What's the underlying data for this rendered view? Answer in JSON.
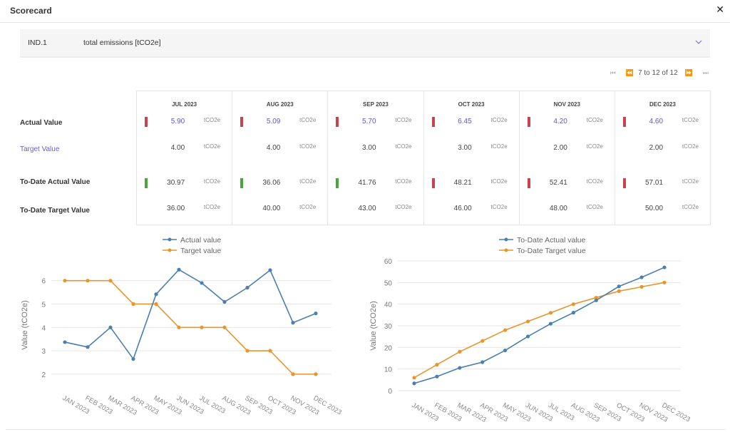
{
  "window": {
    "title": "Scorecard",
    "close_icon": "close-icon"
  },
  "indicator": {
    "code": "IND.1",
    "name": "total emissions [tCO2e]",
    "expand_icon": "chevron-down-icon"
  },
  "pager": {
    "info": "7 to 12 of 12",
    "first": "first-page-icon",
    "prev": "prev-page-icon",
    "next": "next-page-icon",
    "last": "last-page-icon"
  },
  "row_labels": [
    "Actual Value",
    "Target Value",
    "To-Date Actual Value",
    "To-Date Target Value"
  ],
  "unit": "tCO2e",
  "colors": {
    "bad": "#c9434f",
    "good": "#4aa63b",
    "link": "#6a5fc1",
    "actual_line": "#4a7fb0",
    "target_line": "#e8962c"
  },
  "periods": [
    {
      "label": "JUL 2023",
      "actual": "5.90",
      "actual_status": "bad",
      "target": "4.00",
      "todate_actual": "30.97",
      "todate_status": "good",
      "todate_target": "36.00"
    },
    {
      "label": "AUG 2023",
      "actual": "5.09",
      "actual_status": "bad",
      "target": "4.00",
      "todate_actual": "36.06",
      "todate_status": "good",
      "todate_target": "40.00"
    },
    {
      "label": "SEP 2023",
      "actual": "5.70",
      "actual_status": "bad",
      "target": "3.00",
      "todate_actual": "41.76",
      "todate_status": "good",
      "todate_target": "43.00"
    },
    {
      "label": "OCT 2023",
      "actual": "6.45",
      "actual_status": "bad",
      "target": "3.00",
      "todate_actual": "48.21",
      "todate_status": "bad",
      "todate_target": "46.00"
    },
    {
      "label": "NOV 2023",
      "actual": "4.20",
      "actual_status": "bad",
      "target": "2.00",
      "todate_actual": "52.41",
      "todate_status": "bad",
      "todate_target": "48.00"
    },
    {
      "label": "DEC 2023",
      "actual": "4.60",
      "actual_status": "bad",
      "target": "2.00",
      "todate_actual": "57.01",
      "todate_status": "bad",
      "todate_target": "50.00"
    }
  ],
  "chart_data": [
    {
      "type": "line",
      "title": "",
      "xlabel": "",
      "ylabel": "Value (tCO2e)",
      "categories": [
        "JAN 2023",
        "FEB 2023",
        "MAR 2023",
        "APR 2023",
        "MAY 2023",
        "JUN 2023",
        "JUL 2023",
        "AUG 2023",
        "SEP 2023",
        "OCT 2023",
        "NOV 2023",
        "DEC 2023"
      ],
      "yticks": [
        2,
        3,
        4,
        5,
        6
      ],
      "ylim": [
        1.6,
        6.6
      ],
      "grid": true,
      "legend": "top-center",
      "series": [
        {
          "name": "Actual value",
          "color": "#4a7fb0",
          "values": [
            3.37,
            3.16,
            4.0,
            2.65,
            5.42,
            6.47,
            5.9,
            5.09,
            5.7,
            6.45,
            4.2,
            4.6
          ]
        },
        {
          "name": "Target value",
          "color": "#e8962c",
          "values": [
            6,
            6,
            6,
            5,
            5,
            4,
            4,
            4,
            3,
            3,
            2,
            2
          ]
        }
      ]
    },
    {
      "type": "line",
      "title": "",
      "xlabel": "",
      "ylabel": "Value (tCO2e)",
      "categories": [
        "JAN 2023",
        "FEB 2023",
        "MAR 2023",
        "APR 2023",
        "MAY 2023",
        "JUN 2023",
        "JUL 2023",
        "AUG 2023",
        "SEP 2023",
        "OCT 2023",
        "NOV 2023",
        "DEC 2023"
      ],
      "yticks": [
        0,
        10,
        20,
        30,
        40,
        50,
        60
      ],
      "ylim": [
        0,
        60
      ],
      "grid": true,
      "legend": "top-center",
      "series": [
        {
          "name": "To-Date Actual value",
          "color": "#4a7fb0",
          "values": [
            3.37,
            6.53,
            10.53,
            13.18,
            18.6,
            25.07,
            30.97,
            36.06,
            41.76,
            48.21,
            52.41,
            57.01
          ]
        },
        {
          "name": "To-Date Target value",
          "color": "#e8962c",
          "values": [
            6,
            12,
            18,
            23,
            28,
            32,
            36,
            40,
            43,
            46,
            48,
            50
          ]
        }
      ]
    }
  ]
}
